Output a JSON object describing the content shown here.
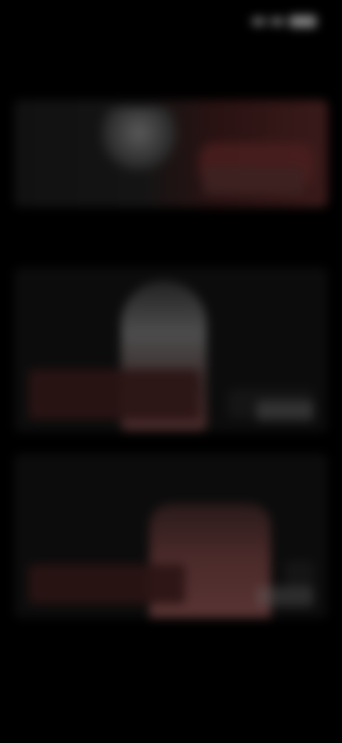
{
  "status_bar": {
    "time": "",
    "icons": [
      "signal-icon",
      "wifi-icon",
      "battery-icon"
    ]
  },
  "page": {
    "title": ""
  },
  "hero": {
    "title": "",
    "description": "",
    "button_label": ""
  },
  "section": {
    "title": ""
  },
  "cards": [
    {
      "title": "",
      "subtitle": ""
    },
    {
      "title": "",
      "subtitle": ""
    }
  ],
  "colors": {
    "background": "#000000",
    "accent_dark_red": "#3d2121",
    "text_gray": "#8a8a8a"
  }
}
